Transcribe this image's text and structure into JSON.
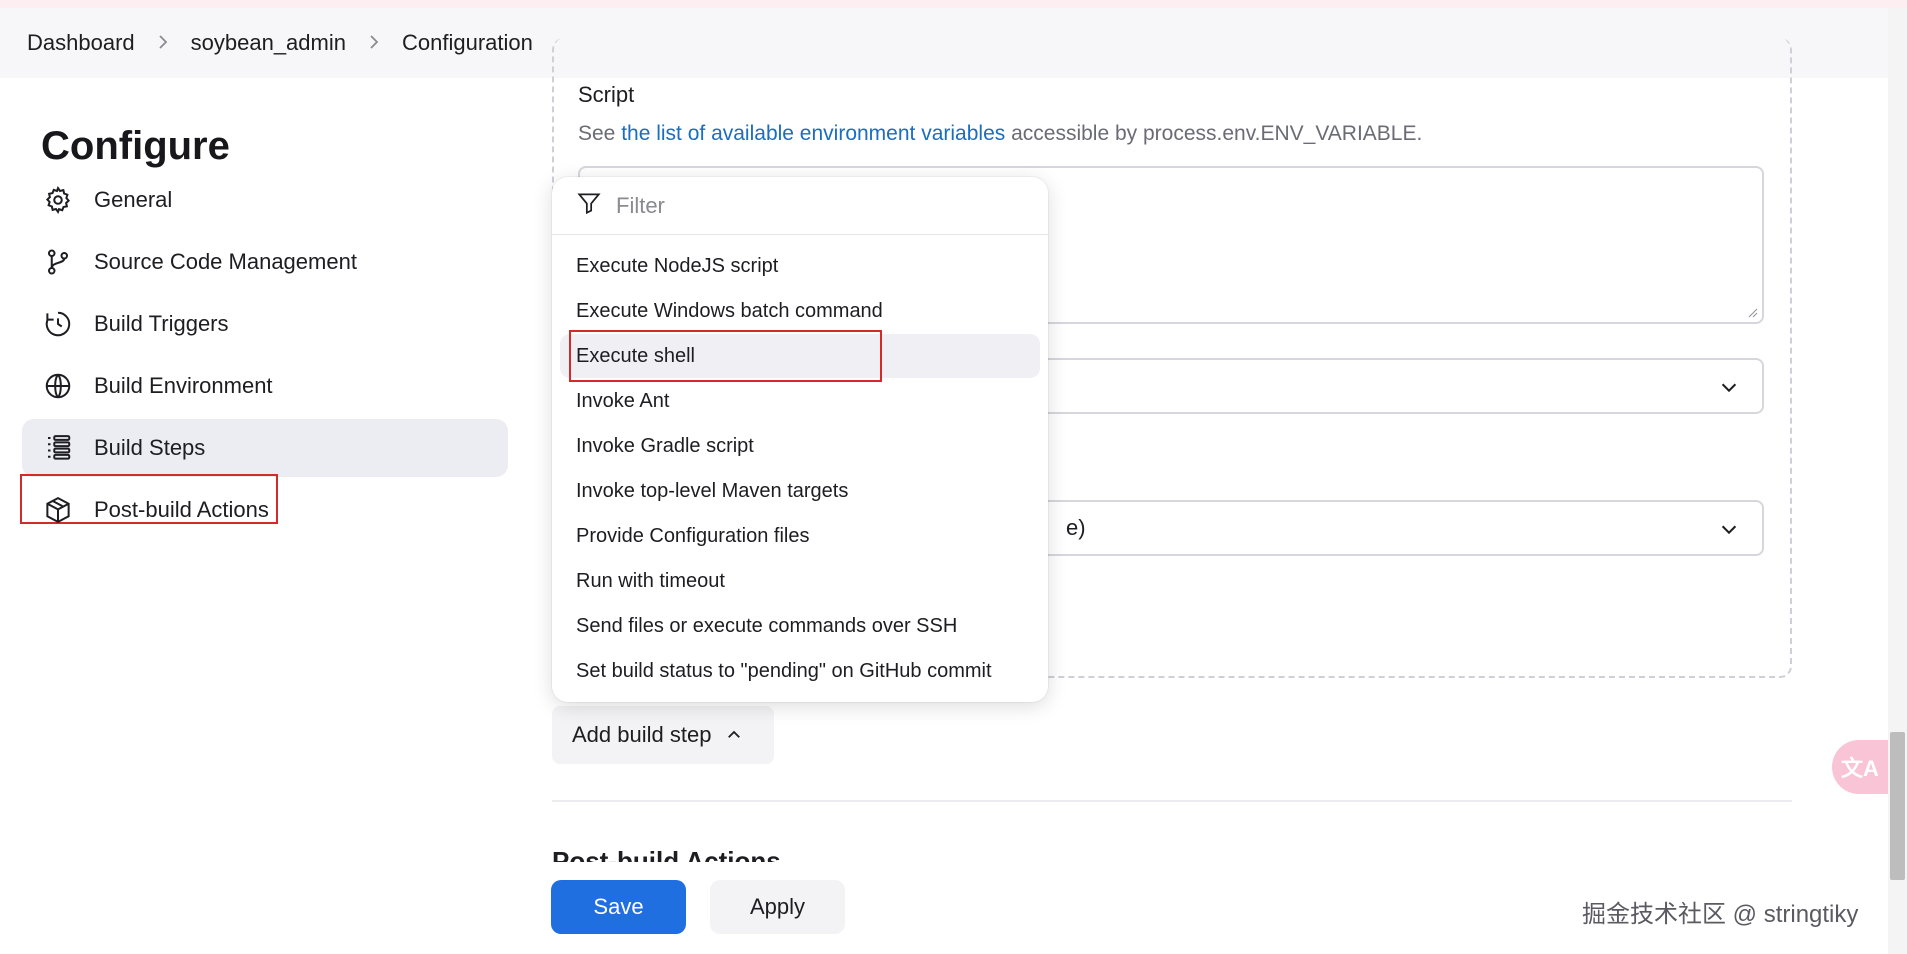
{
  "breadcrumb": {
    "items": [
      "Dashboard",
      "soybean_admin",
      "Configuration"
    ],
    "separator": ">"
  },
  "sidebar": {
    "title": "Configure",
    "items": [
      {
        "label": "General",
        "icon": "gear-icon"
      },
      {
        "label": "Source Code Management",
        "icon": "branch-icon"
      },
      {
        "label": "Build Triggers",
        "icon": "clock-icon"
      },
      {
        "label": "Build Environment",
        "icon": "globe-icon"
      },
      {
        "label": "Build Steps",
        "icon": "list-icon",
        "active": true
      },
      {
        "label": "Post-build Actions",
        "icon": "package-icon"
      }
    ]
  },
  "main": {
    "script_label": "Script",
    "script_help_prefix": "See ",
    "script_help_link": "the list of available environment variables",
    "script_help_suffix": " accessible by process.env.ENV_VARIABLE.",
    "select_2_partial": "e)",
    "add_build_step_label": "Add build step",
    "post_build_heading": "Post-build Actions"
  },
  "dropdown": {
    "filter_placeholder": "Filter",
    "items": [
      "Execute NodeJS script",
      "Execute Windows batch command",
      "Execute shell",
      "Invoke Ant",
      "Invoke Gradle script",
      "Invoke top-level Maven targets",
      "Provide Configuration files",
      "Run with timeout",
      "Send files or execute commands over SSH",
      "Set build status to \"pending\" on GitHub commit"
    ],
    "hovered_index": 2
  },
  "actions": {
    "save_label": "Save",
    "apply_label": "Apply"
  },
  "watermark": "掘金技术社区 @ stringtiky",
  "translate_fab": "文A",
  "colors": {
    "primary": "#1f6fe0",
    "link": "#1b6dbf",
    "highlight_box": "#d42a2a",
    "active_bg": "#ececf3"
  }
}
